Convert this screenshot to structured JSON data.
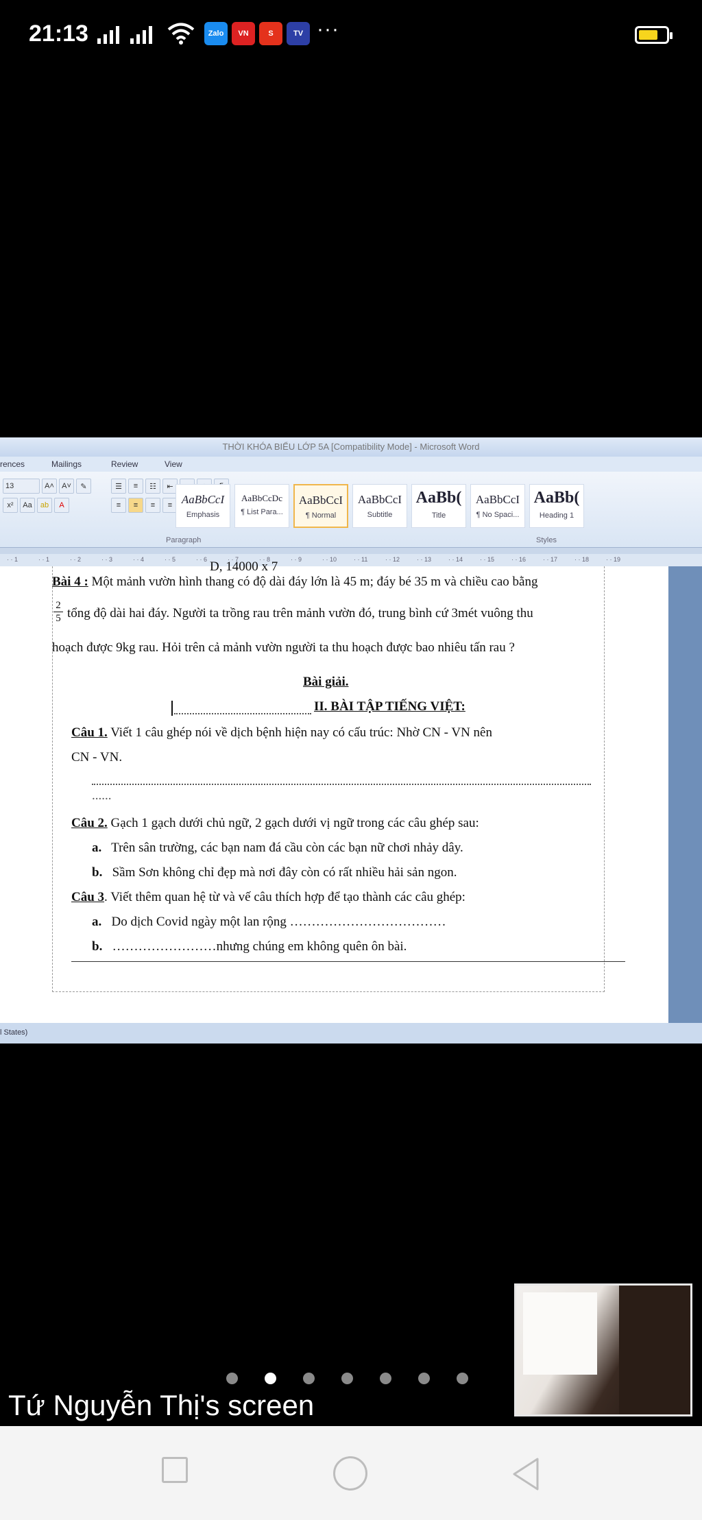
{
  "status": {
    "time": "21:13",
    "app_icons": [
      {
        "name": "zalo-app-icon",
        "label": "Zalo",
        "color": "#1a8cf0"
      },
      {
        "name": "vnexpress-app-icon",
        "label": "VN",
        "color": "#d22"
      },
      {
        "name": "shopee-app-icon",
        "label": "S",
        "color": "#e4321c"
      },
      {
        "name": "media-app-icon",
        "label": "TV",
        "color": "#2d3fa6"
      }
    ],
    "more": "···",
    "battery_level": 0.7
  },
  "word": {
    "title": "THỜI KHÓA BIỂU LỚP 5A [Compatibility Mode] - Microsoft Word",
    "menu": [
      "rences",
      "Mailings",
      "Review",
      "View"
    ],
    "font_size": "13",
    "paragraph_label": "Paragraph",
    "styles_label": "Styles",
    "styles": [
      {
        "preview": "AaBbCcI",
        "name": "Emphasis"
      },
      {
        "preview": "AaBbCcDc",
        "name": "¶ List Para..."
      },
      {
        "preview": "AaBbCcI",
        "name": "¶ Normal",
        "selected": true
      },
      {
        "preview": "AaBbCcI",
        "name": "Subtitle"
      },
      {
        "preview": "AaBb(",
        "name": "Title"
      },
      {
        "preview": "AaBbCcI",
        "name": "¶ No Spaci..."
      },
      {
        "preview": "AaBb(",
        "name": "Heading 1"
      }
    ],
    "ruler_numbers": [
      "1",
      "1",
      "2",
      "3",
      "4",
      "5",
      "6",
      "7",
      "8",
      "9",
      "10",
      "11",
      "12",
      "13",
      "14",
      "15",
      "16",
      "17",
      "18",
      "19"
    ],
    "status_text": "l States)"
  },
  "doc": {
    "cut_line": "D,   14000 x 7",
    "bai4_label": "Bài 4 :",
    "bai4_l1": "Một mảnh vườn hình thang có độ dài đáy lớn là 45 m; đáy bé 35 m và chiều cao bằng",
    "frac_num": "2",
    "frac_den": "5",
    "bai4_l2": "tổng độ dài hai đáy. Người  ta trồng rau trên mảnh vườn đó, trung bình cứ 3mét vuông thu",
    "bai4_l3": "hoạch được 9kg rau. Hỏi trên cả mảnh vườn người ta thu hoạch được bao nhiêu tấn rau ?",
    "bai_giai": "Bài giải.",
    "section2": "II. BÀI TẬP TIẾNG VIỆT:",
    "cau1_label": "Câu 1.",
    "cau1_text": "Viết 1 câu ghép nói về dịch bệnh hiện nay có cấu trúc:    Nhờ   CN - VN    nên",
    "cau1_cont": "CN - VN.",
    "dots_short": "......",
    "cau2_label": "Câu 2.",
    "cau2_text": "Gạch 1 gạch dưới chủ ngữ, 2 gạch dưới vị ngữ trong các câu ghép sau:",
    "cau2_a_label": "a.",
    "cau2_a": "Trên sân trường, các bạn nam đá cầu còn các bạn nữ chơi nhảy dây.",
    "cau2_b_label": "b.",
    "cau2_b": "Sầm Sơn không chỉ đẹp mà nơi đây còn có rất nhiều hải sản ngon.",
    "cau3_label": "Câu 3",
    "cau3_text": ". Viết thêm quan hệ từ và vế câu thích hợp để tạo thành các câu ghép:",
    "cau3_a_label": "a.",
    "cau3_a": "Do dịch Covid ngày một lan rộng ………………………………",
    "cau3_b_label": "b.",
    "cau3_b": "……………………nhưng chúng em không quên ôn bài."
  },
  "pager": {
    "count": 7,
    "active": 1
  },
  "screen_label": "Tứ Nguyễn Thị's screen"
}
